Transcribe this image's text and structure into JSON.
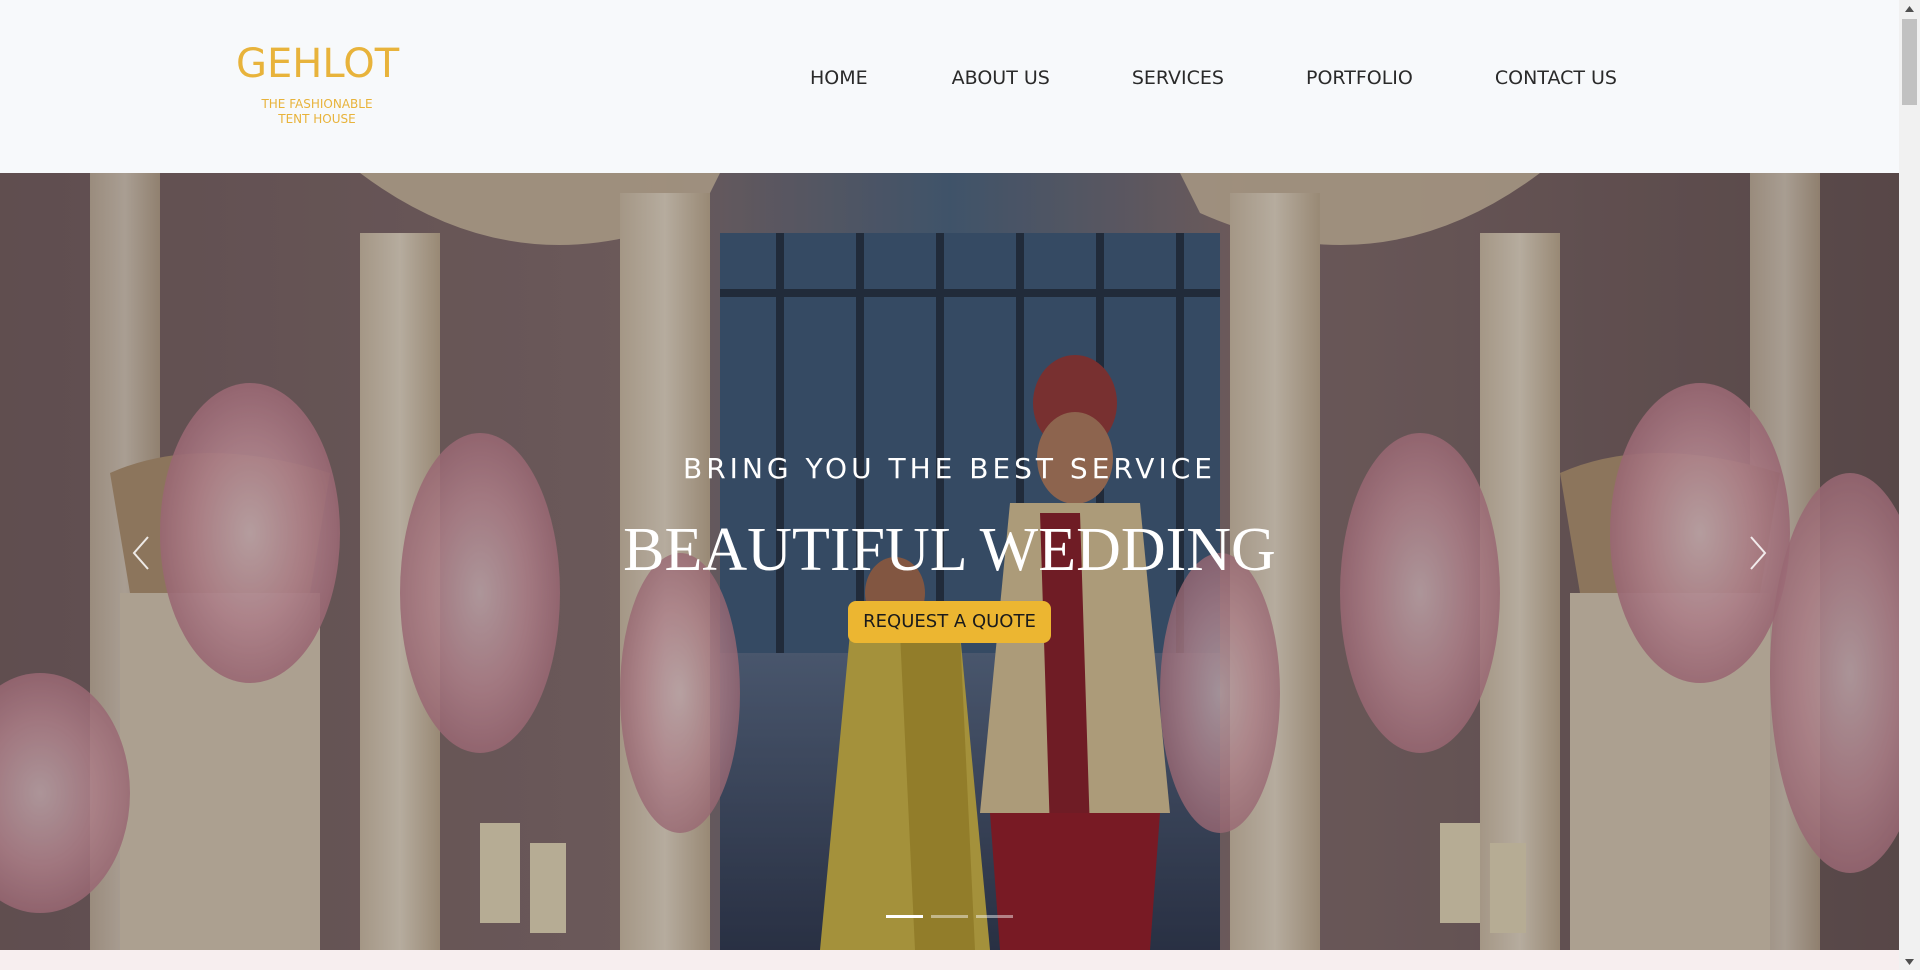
{
  "logo": {
    "title": "GEHLOT",
    "tagline": "THE FASHIONABLE TENT HOUSE"
  },
  "nav": {
    "items": [
      {
        "label": "HOME"
      },
      {
        "label": "ABOUT US"
      },
      {
        "label": "SERVICES"
      },
      {
        "label": "PORTFOLIO"
      },
      {
        "label": "CONTACT US"
      }
    ]
  },
  "hero": {
    "subtitle": "BRING YOU THE BEST SERVICE",
    "title": "BEAUTIFUL WEDDING",
    "cta_label": "REQUEST A QUOTE",
    "background_icon": "wedding-couple-photo",
    "prev_icon": "chevron-left-icon",
    "next_icon": "chevron-right-icon",
    "slides_count": 3,
    "active_slide": 1
  },
  "colors": {
    "accent": "#e8b33b",
    "button": "#ecb631",
    "header_bg": "#f7f9fb",
    "text_dark": "#2a2a2a"
  }
}
